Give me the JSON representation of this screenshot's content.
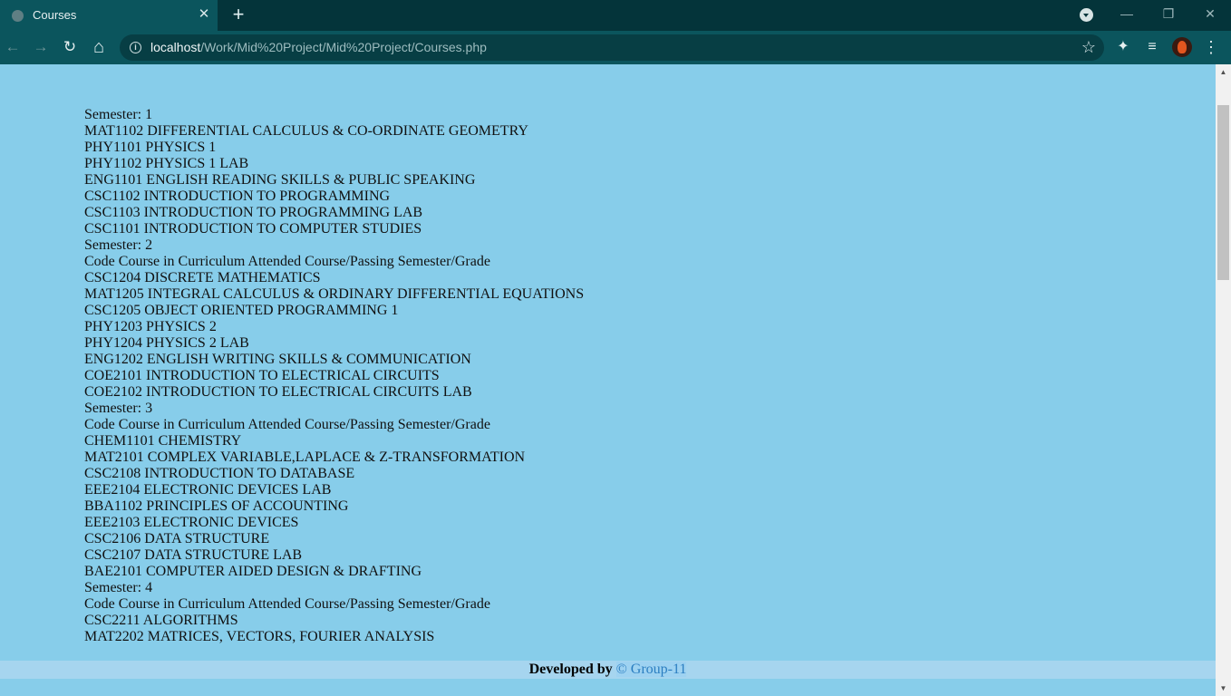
{
  "browser": {
    "tab_title": "Courses",
    "tab_close": "✕",
    "new_tab": "+",
    "url_host": "localhost",
    "url_path": "/Work/Mid%20Project/Mid%20Project/Courses.php",
    "win_minimize": "—",
    "win_restore": "❐",
    "win_close": "✕",
    "back": "←",
    "forward": "→",
    "reload": "↻",
    "home": "⌂",
    "info": "i",
    "star": "☆",
    "extensions": "✦",
    "media": "≡",
    "menu": "⋮"
  },
  "content": {
    "lines": [
      "Semester: 1",
      "MAT1102 DIFFERENTIAL CALCULUS & CO-ORDINATE GEOMETRY",
      "PHY1101 PHYSICS 1",
      "PHY1102 PHYSICS 1 LAB",
      "ENG1101 ENGLISH READING SKILLS & PUBLIC SPEAKING",
      "CSC1102 INTRODUCTION TO PROGRAMMING",
      "CSC1103 INTRODUCTION TO PROGRAMMING LAB",
      "CSC1101 INTRODUCTION TO COMPUTER STUDIES",
      "Semester: 2",
      "Code Course in Curriculum Attended Course/Passing Semester/Grade",
      "CSC1204 DISCRETE MATHEMATICS",
      "MAT1205 INTEGRAL CALCULUS & ORDINARY DIFFERENTIAL EQUATIONS",
      "CSC1205 OBJECT ORIENTED PROGRAMMING 1",
      "PHY1203 PHYSICS 2",
      "PHY1204 PHYSICS 2 LAB",
      "ENG1202 ENGLISH WRITING SKILLS & COMMUNICATION",
      "COE2101 INTRODUCTION TO ELECTRICAL CIRCUITS",
      "COE2102 INTRODUCTION TO ELECTRICAL CIRCUITS LAB",
      "Semester: 3",
      "Code Course in Curriculum Attended Course/Passing Semester/Grade",
      "CHEM1101 CHEMISTRY",
      "MAT2101 COMPLEX VARIABLE,LAPLACE & Z-TRANSFORMATION",
      "CSC2108 INTRODUCTION TO DATABASE",
      "EEE2104 ELECTRONIC DEVICES LAB",
      "BBA1102 PRINCIPLES OF ACCOUNTING",
      "EEE2103 ELECTRONIC DEVICES",
      "CSC2106 DATA STRUCTURE",
      "CSC2107 DATA STRUCTURE LAB",
      "BAE2101 COMPUTER AIDED DESIGN & DRAFTING",
      "Semester: 4",
      "Code Course in Curriculum Attended Course/Passing Semester/Grade",
      "CSC2211 ALGORITHMS",
      "MAT2202 MATRICES, VECTORS, FOURIER ANALYSIS"
    ]
  },
  "footer": {
    "prefix": "Developed by",
    "group": "© Group-11"
  },
  "scrollbar": {
    "up": "▲",
    "down": "▼"
  },
  "colors": {
    "page_bg": "#87cdea",
    "footer_bg": "#a6d5ef",
    "link": "#2b7ec1"
  }
}
